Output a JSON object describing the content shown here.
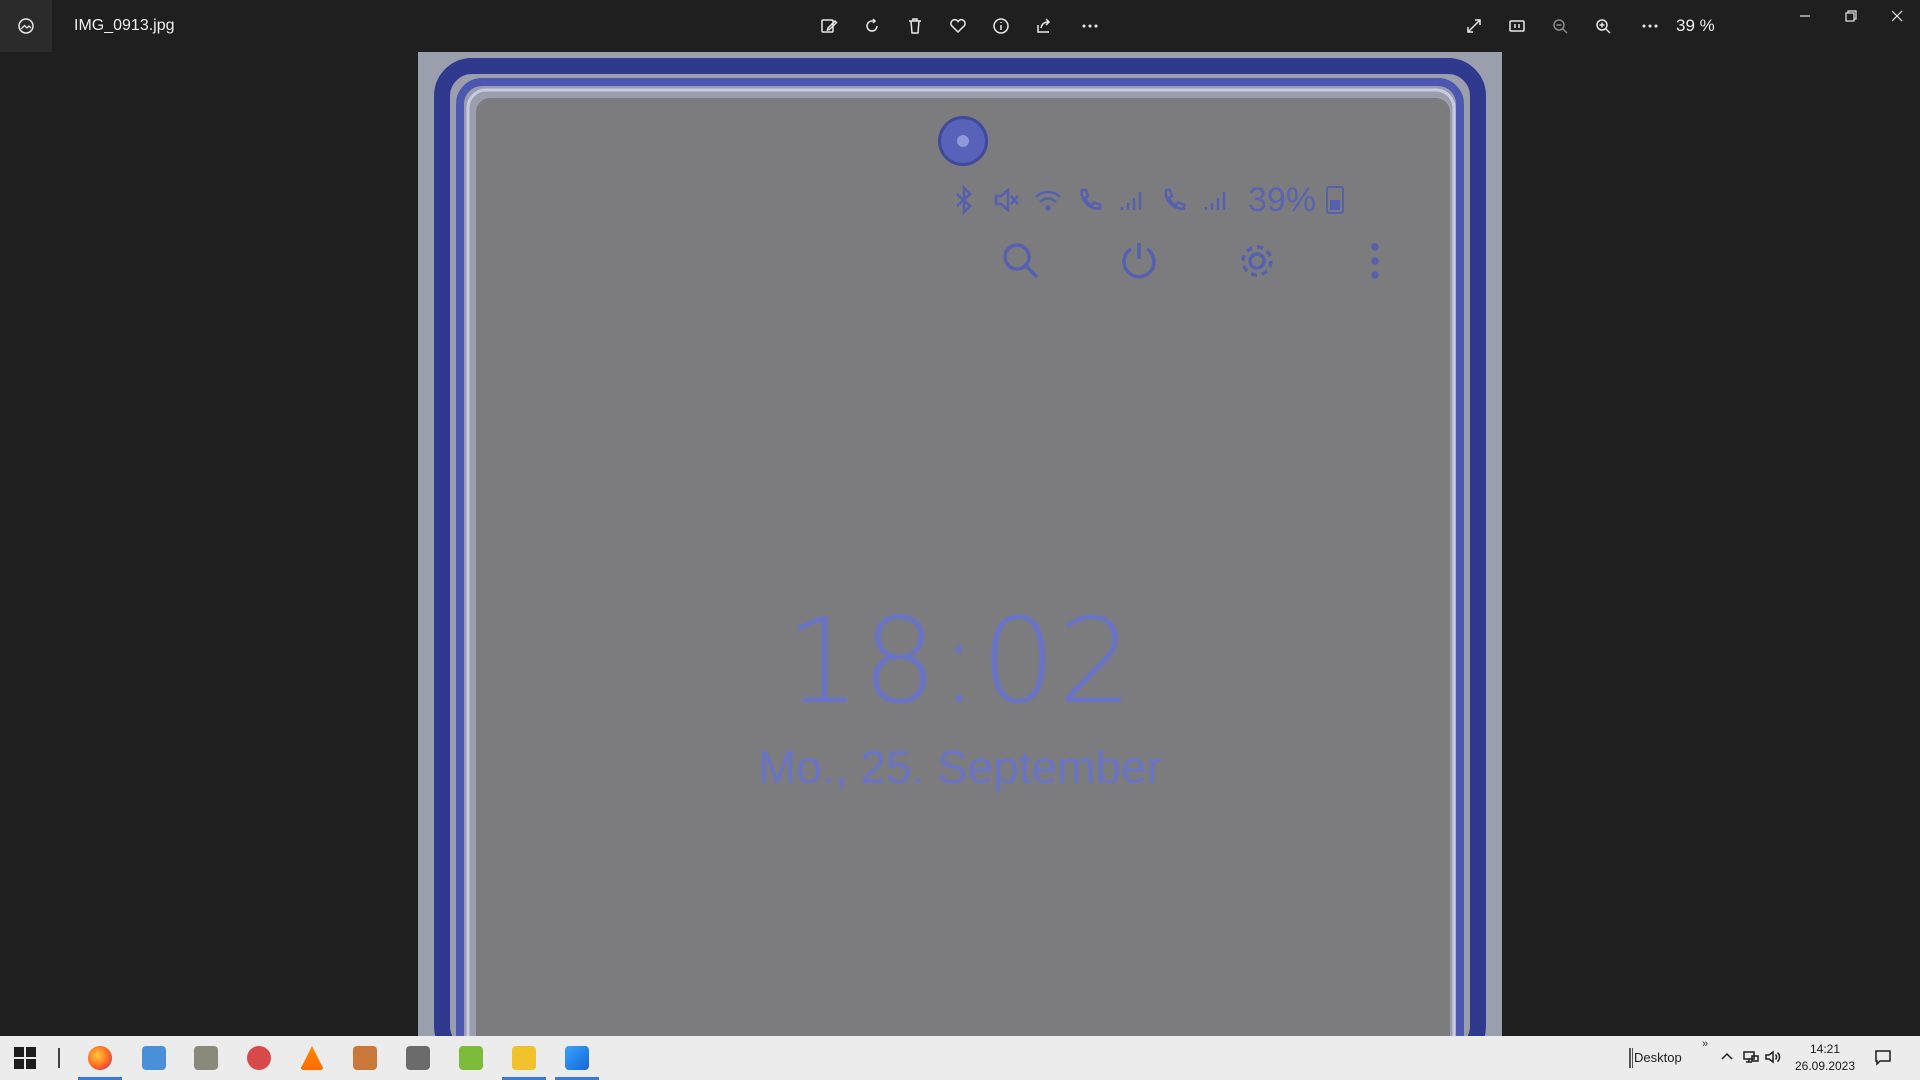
{
  "window": {
    "filename": "IMG_0913.jpg",
    "zoom_label": "39 %"
  },
  "toolbar": {
    "icons": [
      "edit-icon",
      "rotate-icon",
      "delete-icon",
      "favorite-icon",
      "info-icon",
      "share-icon",
      "more-icon"
    ],
    "right_icons": [
      "fullscreen-icon",
      "actual-size-icon",
      "zoom-out-icon",
      "zoom-in-icon",
      "more-icon"
    ]
  },
  "phone": {
    "battery": "39%",
    "clock": "18:02",
    "date": "Mo., 25. September",
    "status_icons": [
      "bluetooth-icon",
      "mute-icon",
      "wifi-call-icon",
      "call-icon",
      "signal-icon",
      "call-2-icon",
      "signal-2-icon"
    ],
    "quick_icons": [
      "search-icon",
      "power-icon",
      "settings-icon",
      "more-vertical-icon"
    ],
    "colors": {
      "accent": "#5560b0",
      "screen": "#7c7c7e"
    }
  },
  "taskbar": {
    "apps": [
      "firefox",
      "laptop-app",
      "scanner-app",
      "paint-app",
      "vlc",
      "archive-app",
      "network-app",
      "notepad-app",
      "file-explorer",
      "photos"
    ],
    "desktop_label": "Desktop",
    "time": "14:21",
    "date": "26.09.2023"
  }
}
